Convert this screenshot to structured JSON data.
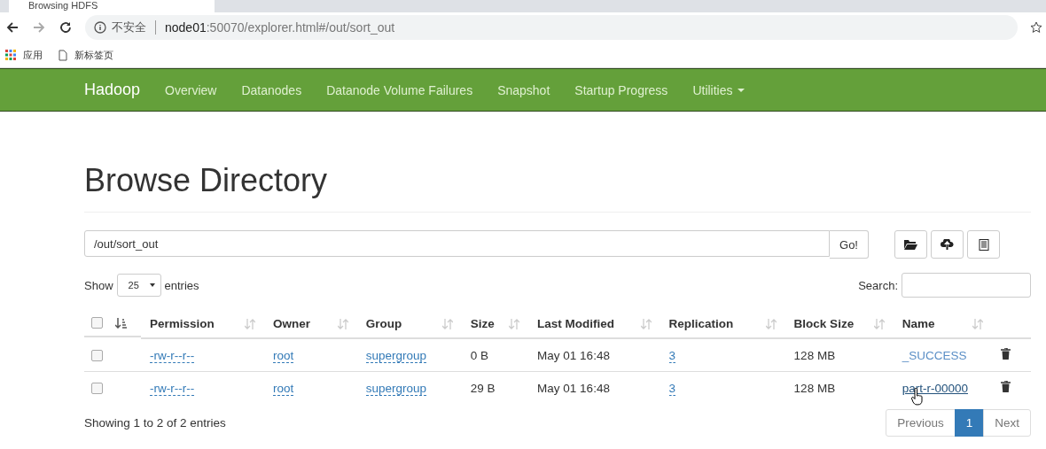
{
  "browser": {
    "tab_title": "Browsing HDFS",
    "security_label": "不安全",
    "url_host": "node01",
    "url_rest": ":50070/explorer.html#/out/sort_out",
    "bookmarks": [
      "应用",
      "新标签页"
    ]
  },
  "navbar": {
    "brand": "Hadoop",
    "items": [
      {
        "label": "Overview",
        "dropdown": false
      },
      {
        "label": "Datanodes",
        "dropdown": false
      },
      {
        "label": "Datanode Volume Failures",
        "dropdown": false
      },
      {
        "label": "Snapshot",
        "dropdown": false
      },
      {
        "label": "Startup Progress",
        "dropdown": false
      },
      {
        "label": "Utilities",
        "dropdown": true
      }
    ]
  },
  "heading": "Browse Directory",
  "path_bar": {
    "value": "/out/sort_out",
    "go_button": "Go!"
  },
  "length_control": {
    "prefix": "Show",
    "value": "25",
    "suffix": "entries"
  },
  "search": {
    "label": "Search:"
  },
  "table": {
    "columns": [
      {
        "label": "Permission",
        "sorted": false
      },
      {
        "label": "Owner",
        "sorted": false
      },
      {
        "label": "Group",
        "sorted": false
      },
      {
        "label": "Size",
        "sorted": false
      },
      {
        "label": "Last Modified",
        "sorted": false
      },
      {
        "label": "Replication",
        "sorted": false
      },
      {
        "label": "Block Size",
        "sorted": false
      },
      {
        "label": "Name",
        "sorted": false
      }
    ],
    "checkbox_column_sorted": true,
    "select_all_checked": false,
    "rows": [
      {
        "checked": false,
        "permission": "-rw-r--r--",
        "owner": "root",
        "group": "supergroup",
        "size": "0 B",
        "last_modified": "May 01 16:48",
        "replication": "3",
        "block_size": "128 MB",
        "name": "_SUCCESS",
        "hovered": false
      },
      {
        "checked": false,
        "permission": "-rw-r--r--",
        "owner": "root",
        "group": "supergroup",
        "size": "29 B",
        "last_modified": "May 01 16:48",
        "replication": "3",
        "block_size": "128 MB",
        "name": "part-r-00000",
        "hovered": true
      }
    ]
  },
  "info": "Showing 1 to 2 of 2 entries",
  "pagination": [
    {
      "label": "Previous",
      "selected": false
    },
    {
      "label": "1",
      "selected": true
    },
    {
      "label": "Next",
      "selected": false
    }
  ]
}
